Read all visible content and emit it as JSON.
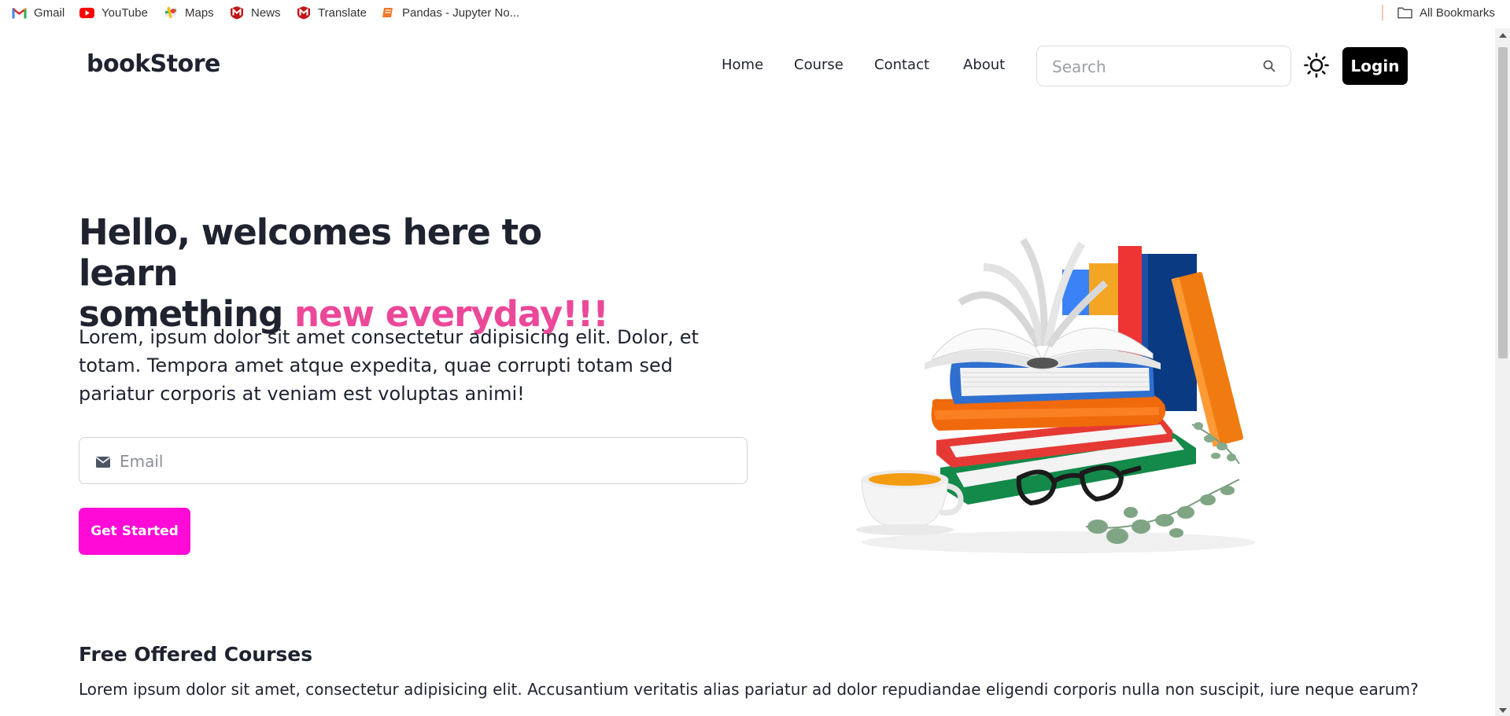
{
  "bookmarks": [
    {
      "label": "Gmail",
      "icon": "gmail-icon"
    },
    {
      "label": "YouTube",
      "icon": "youtube-icon"
    },
    {
      "label": "Maps",
      "icon": "maps-icon"
    },
    {
      "label": "News",
      "icon": "news-icon"
    },
    {
      "label": "Translate",
      "icon": "translate-icon"
    },
    {
      "label": "Pandas - Jupyter No...",
      "icon": "jupyter-icon"
    }
  ],
  "all_bookmarks_label": "All Bookmarks",
  "navbar": {
    "brand": "bookStore",
    "links": [
      "Home",
      "Course",
      "Contact",
      "About"
    ],
    "search_placeholder": "Search",
    "login_label": "Login",
    "theme_icon": "sun-icon"
  },
  "hero": {
    "title_line1": "Hello, welcomes here to learn",
    "title_line2_plain": "something ",
    "title_line2_accent": "new everyday!!!",
    "description": "Lorem, ipsum dolor sit amet consectetur adipisicing elit. Dolor, et totam. Tempora amet atque expedita, quae corrupti totam sed pariatur corporis at veniam est voluptas animi!",
    "email_placeholder": "Email",
    "cta_label": "Get Started"
  },
  "courses": {
    "title": "Free Offered Courses",
    "description": "Lorem ipsum dolor sit amet, consectetur adipisicing elit. Accusantium veritatis alias pariatur ad dolor repudiandae eligendi corporis nulla non suscipit, iure neque earum?"
  },
  "colors": {
    "accent_pink": "#ec4899",
    "cta_magenta": "#ff0ad6",
    "text_dark": "#1f2330",
    "login_black": "#000000"
  }
}
